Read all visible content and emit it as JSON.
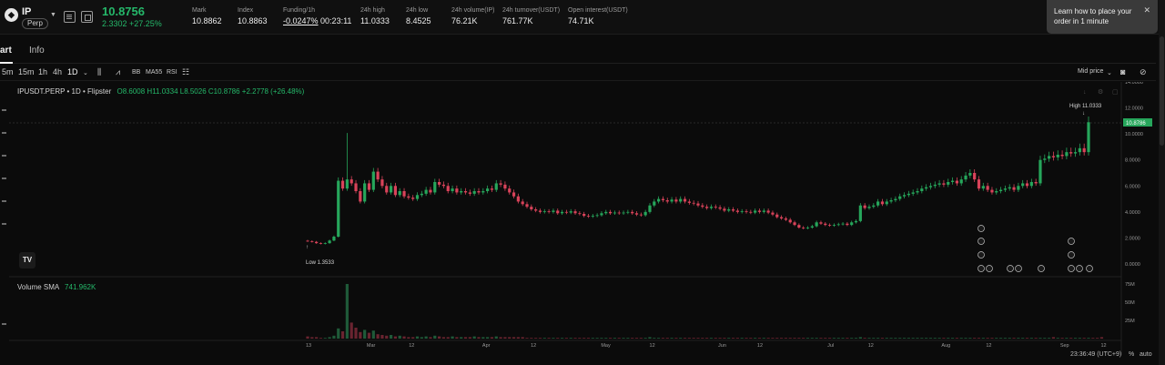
{
  "ticker": {
    "logo_glyph": "◆",
    "symbol": "IP",
    "contract_tag": "Perp",
    "last_price": "10.8756",
    "change": "2.3302 +27.25%",
    "stats": [
      {
        "label": "Mark",
        "value": "10.8862"
      },
      {
        "label": "Index",
        "value": "10.8863"
      },
      {
        "label": "Funding/1h",
        "value": "-0.0247%",
        "extra": "00:23:11"
      },
      {
        "label": "24h high",
        "value": "11.0333"
      },
      {
        "label": "24h low",
        "value": "8.4525"
      },
      {
        "label": "24h volume(IP)",
        "value": "76.21K"
      },
      {
        "label": "24h turnover(USDT)",
        "value": "761.77K"
      },
      {
        "label": "Open interest(USDT)",
        "value": "74.71K"
      }
    ]
  },
  "toast": {
    "message": "Learn how to place your order in 1 minute",
    "close": "✕"
  },
  "tabs": [
    {
      "label": "art",
      "active": true
    },
    {
      "label": "Info",
      "active": false
    }
  ],
  "chart_toolbar": {
    "intervals": [
      "5m",
      "15m",
      "1h",
      "4h",
      "1D"
    ],
    "indicators": [
      "BB",
      "MA55",
      "RSI"
    ],
    "price_source": "Mid price"
  },
  "chart_data": {
    "type": "candlestick",
    "title": "IPUSDT.PERP • 1D • Flipster",
    "ohlc_legend": "O8.6008 H11.0334 L8.5026 C10.8786 +2.2778 (+26.48%)",
    "y_axis_ticks": [
      "14.0000",
      "12.0000",
      "10.0000",
      "8.0000",
      "6.0000",
      "4.0000",
      "2.0000",
      "0.0000"
    ],
    "ylim": [
      0,
      14
    ],
    "x_axis_ticks": [
      "13",
      "Mar",
      "12",
      "Apr",
      "12",
      "May",
      "12",
      "Jun",
      "12",
      "Jul",
      "12",
      "Aug",
      "12",
      "Sep",
      "12"
    ],
    "current_price_label": "10.8786",
    "high_marker": "High 11.0333",
    "low_marker": "Low 1.3533",
    "close_series": [
      1.75,
      1.7,
      1.6,
      1.55,
      1.6,
      1.8,
      2.1,
      6.4,
      5.8,
      6.5,
      6.2,
      5.6,
      4.8,
      6.2,
      5.7,
      7.1,
      6.5,
      6.0,
      5.5,
      6.0,
      5.3,
      5.6,
      5.2,
      5.1,
      5.0,
      5.3,
      5.4,
      5.7,
      5.5,
      6.3,
      6.1,
      6.0,
      5.6,
      5.8,
      5.5,
      5.6,
      5.5,
      5.4,
      5.6,
      5.5,
      5.6,
      5.8,
      5.7,
      6.2,
      6.1,
      5.8,
      5.5,
      5.2,
      4.8,
      4.6,
      4.4,
      4.2,
      4.1,
      4.0,
      4.05,
      4.0,
      4.1,
      3.9,
      4.0,
      3.95,
      4.05,
      3.9,
      3.85,
      3.7,
      3.65,
      3.7,
      3.75,
      3.9,
      4.0,
      3.9,
      3.95,
      3.9,
      3.95,
      4.0,
      3.9,
      3.8,
      3.75,
      4.0,
      4.5,
      4.8,
      5.0,
      4.9,
      4.8,
      4.95,
      4.8,
      5.0,
      4.8,
      4.7,
      4.65,
      4.5,
      4.4,
      4.3,
      4.4,
      4.35,
      4.25,
      4.1,
      4.2,
      4.1,
      4.0,
      4.05,
      4.0,
      3.95,
      4.1,
      4.0,
      4.1,
      3.95,
      3.8,
      3.6,
      3.5,
      3.4,
      3.2,
      3.0,
      2.8,
      2.75,
      2.8,
      2.9,
      3.2,
      3.1,
      3.0,
      2.95,
      3.0,
      3.05,
      3.1,
      3.0,
      3.2,
      3.3,
      4.5,
      4.3,
      4.4,
      4.5,
      4.8,
      4.6,
      4.8,
      4.9,
      5.0,
      5.2,
      5.3,
      5.4,
      5.5,
      5.6,
      5.8,
      5.9,
      6.0,
      6.1,
      6.2,
      6.1,
      6.3,
      6.4,
      6.2,
      6.5,
      6.8,
      7.0,
      6.5,
      5.8,
      6.0,
      5.7,
      5.5,
      5.6,
      5.7,
      5.8,
      5.9,
      5.7,
      6.0,
      6.2,
      6.0,
      6.3,
      6.2,
      8.0,
      8.1,
      8.3,
      8.2,
      8.4,
      8.3,
      8.6,
      8.5,
      8.6,
      8.9,
      8.6,
      10.9
    ],
    "volume_legend": "Volume SMA",
    "volume_sma": "741.962K",
    "volume_axis_ticks": [
      "75M",
      "50M",
      "25M"
    ],
    "volume_series": [
      3,
      2,
      2,
      1,
      1,
      2,
      4,
      14,
      10,
      75,
      22,
      15,
      9,
      12,
      8,
      11,
      6,
      5,
      4,
      5,
      3,
      4,
      3,
      2,
      2,
      3,
      2,
      3,
      2,
      4,
      3,
      2,
      2,
      3,
      2,
      2,
      2,
      2,
      3,
      2,
      2,
      2,
      2,
      3,
      2,
      2,
      2,
      2,
      2,
      2,
      1,
      1,
      1,
      1,
      1,
      1,
      1,
      1,
      1,
      1,
      1,
      1,
      1,
      1,
      1,
      1,
      1,
      1,
      1,
      1,
      1,
      1,
      1,
      1,
      1,
      1,
      1,
      1,
      2,
      1,
      1,
      1,
      1,
      1,
      1,
      1,
      1,
      1,
      1,
      1,
      1,
      1,
      1,
      1,
      1,
      1,
      1,
      1,
      1,
      1,
      1,
      1,
      1,
      1,
      1,
      1,
      1,
      1,
      1,
      1,
      1,
      1,
      1,
      1,
      1,
      1,
      1,
      1,
      1,
      1,
      1,
      1,
      1,
      1,
      1,
      1,
      2,
      1,
      1,
      1,
      1,
      1,
      1,
      1,
      1,
      1,
      1,
      1,
      1,
      1,
      1,
      1,
      1,
      1,
      1,
      1,
      1,
      1,
      1,
      1,
      1,
      1,
      1,
      1,
      1,
      1,
      1,
      1,
      1,
      1,
      1,
      1,
      1,
      1,
      1,
      1,
      1,
      1,
      1,
      1,
      2,
      1,
      1,
      1,
      1,
      1,
      1,
      1,
      1,
      1,
      1,
      2
    ],
    "up_color": "#26a65b",
    "down_color": "#d9435a"
  },
  "status": {
    "clock": "23:36:49 (UTC+9)",
    "percent_toggle": "%",
    "auto_toggle": "auto"
  },
  "watermark": "TV"
}
